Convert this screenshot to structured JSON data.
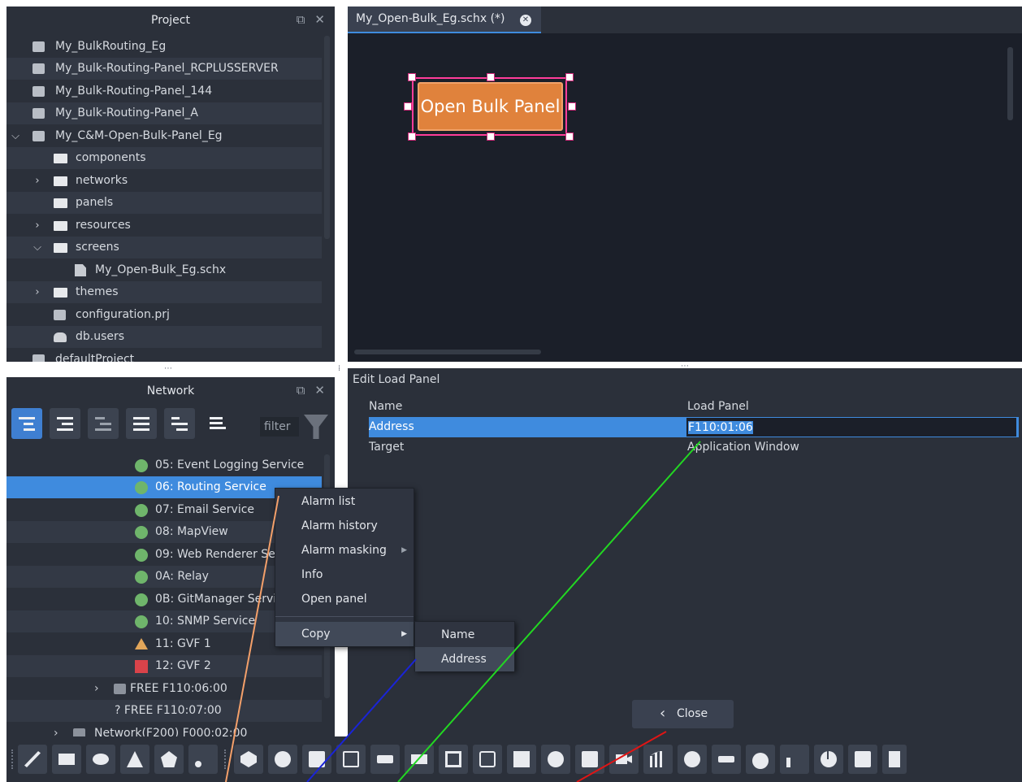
{
  "project": {
    "title": "Project",
    "items": [
      {
        "label": "My_BulkRouting_Eg"
      },
      {
        "label": "My_Bulk-Routing-Panel_RCPLUSSERVER"
      },
      {
        "label": "My_Bulk-Routing-Panel_144"
      },
      {
        "label": "My_Bulk-Routing-Panel_A"
      },
      {
        "label": "My_C&M-Open-Bulk-Panel_Eg"
      },
      {
        "label": "components"
      },
      {
        "label": "networks"
      },
      {
        "label": "panels"
      },
      {
        "label": "resources"
      },
      {
        "label": "screens"
      },
      {
        "label": "My_Open-Bulk_Eg.schx"
      },
      {
        "label": "themes"
      },
      {
        "label": "configuration.prj"
      },
      {
        "label": "db.users"
      },
      {
        "label": "defaultProject"
      }
    ]
  },
  "network": {
    "title": "Network",
    "filter_placeholder": "filter",
    "items": [
      {
        "label": "05: Event Logging Service",
        "status": "ok"
      },
      {
        "label": "06: Routing Service",
        "status": "ok"
      },
      {
        "label": "07: Email Service",
        "status": "ok"
      },
      {
        "label": "08: MapView",
        "status": "ok"
      },
      {
        "label": "09: Web Renderer Service",
        "status": "ok"
      },
      {
        "label": "0A: Relay",
        "status": "ok"
      },
      {
        "label": "0B: GitManager Service",
        "status": "ok"
      },
      {
        "label": "10: SNMP Service",
        "status": "ok"
      },
      {
        "label": "11: GVF 1",
        "status": "warning"
      },
      {
        "label": "12: GVF 2",
        "status": "error"
      },
      {
        "label": "FREE F110:06:00",
        "status": "free"
      },
      {
        "label": "? FREE F110:07:00",
        "status": "unknown"
      },
      {
        "label": "Network(F200) F000:02:00",
        "status": "network"
      }
    ],
    "status_colors": {
      "ok": "#6fb56b",
      "warning": "#e2a65a",
      "error": "#d9434a"
    }
  },
  "editor": {
    "tab_label": "My_Open-Bulk_Eg.schx (*)",
    "widget_label": "Open Bulk Panel",
    "accent": "#e0823c"
  },
  "properties": {
    "title": "Edit Load Panel",
    "rows": [
      {
        "name": "Name",
        "value": "Load Panel"
      },
      {
        "name": "Address",
        "value": "F110:01:06"
      },
      {
        "name": "Target",
        "value": "Application Window"
      }
    ],
    "close_label": "Close"
  },
  "context_menu": {
    "items": [
      "Alarm list",
      "Alarm history",
      "Alarm masking",
      "Info",
      "Open panel",
      "Copy"
    ],
    "copy_submenu": [
      "Name",
      "Address"
    ]
  },
  "icons": {
    "panel_float": "float-icon",
    "panel_close": "close-icon"
  }
}
